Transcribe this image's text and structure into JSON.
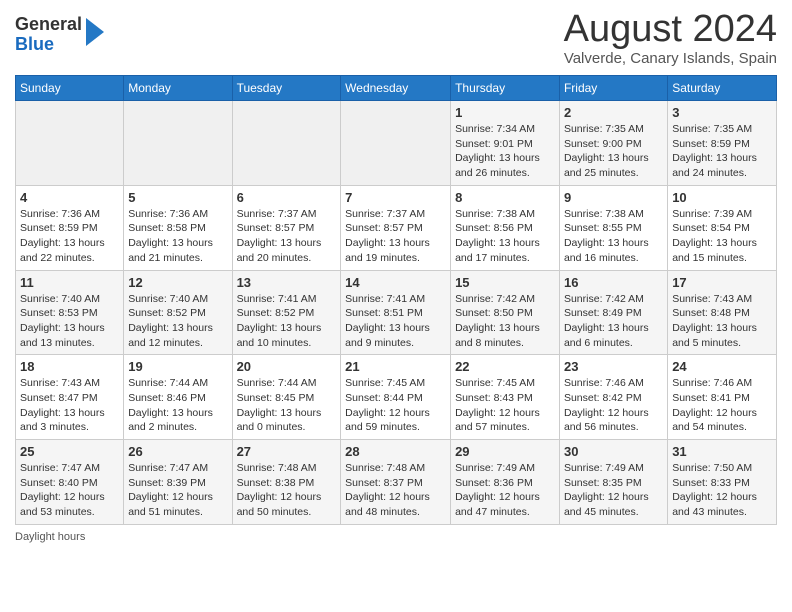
{
  "header": {
    "logo_general": "General",
    "logo_blue": "Blue",
    "month_title": "August 2024",
    "location": "Valverde, Canary Islands, Spain"
  },
  "calendar": {
    "days_of_week": [
      "Sunday",
      "Monday",
      "Tuesday",
      "Wednesday",
      "Thursday",
      "Friday",
      "Saturday"
    ],
    "weeks": [
      [
        {
          "day": "",
          "info": ""
        },
        {
          "day": "",
          "info": ""
        },
        {
          "day": "",
          "info": ""
        },
        {
          "day": "",
          "info": ""
        },
        {
          "day": "1",
          "info": "Sunrise: 7:34 AM\nSunset: 9:01 PM\nDaylight: 13 hours and 26 minutes."
        },
        {
          "day": "2",
          "info": "Sunrise: 7:35 AM\nSunset: 9:00 PM\nDaylight: 13 hours and 25 minutes."
        },
        {
          "day": "3",
          "info": "Sunrise: 7:35 AM\nSunset: 8:59 PM\nDaylight: 13 hours and 24 minutes."
        }
      ],
      [
        {
          "day": "4",
          "info": "Sunrise: 7:36 AM\nSunset: 8:59 PM\nDaylight: 13 hours and 22 minutes."
        },
        {
          "day": "5",
          "info": "Sunrise: 7:36 AM\nSunset: 8:58 PM\nDaylight: 13 hours and 21 minutes."
        },
        {
          "day": "6",
          "info": "Sunrise: 7:37 AM\nSunset: 8:57 PM\nDaylight: 13 hours and 20 minutes."
        },
        {
          "day": "7",
          "info": "Sunrise: 7:37 AM\nSunset: 8:57 PM\nDaylight: 13 hours and 19 minutes."
        },
        {
          "day": "8",
          "info": "Sunrise: 7:38 AM\nSunset: 8:56 PM\nDaylight: 13 hours and 17 minutes."
        },
        {
          "day": "9",
          "info": "Sunrise: 7:38 AM\nSunset: 8:55 PM\nDaylight: 13 hours and 16 minutes."
        },
        {
          "day": "10",
          "info": "Sunrise: 7:39 AM\nSunset: 8:54 PM\nDaylight: 13 hours and 15 minutes."
        }
      ],
      [
        {
          "day": "11",
          "info": "Sunrise: 7:40 AM\nSunset: 8:53 PM\nDaylight: 13 hours and 13 minutes."
        },
        {
          "day": "12",
          "info": "Sunrise: 7:40 AM\nSunset: 8:52 PM\nDaylight: 13 hours and 12 minutes."
        },
        {
          "day": "13",
          "info": "Sunrise: 7:41 AM\nSunset: 8:52 PM\nDaylight: 13 hours and 10 minutes."
        },
        {
          "day": "14",
          "info": "Sunrise: 7:41 AM\nSunset: 8:51 PM\nDaylight: 13 hours and 9 minutes."
        },
        {
          "day": "15",
          "info": "Sunrise: 7:42 AM\nSunset: 8:50 PM\nDaylight: 13 hours and 8 minutes."
        },
        {
          "day": "16",
          "info": "Sunrise: 7:42 AM\nSunset: 8:49 PM\nDaylight: 13 hours and 6 minutes."
        },
        {
          "day": "17",
          "info": "Sunrise: 7:43 AM\nSunset: 8:48 PM\nDaylight: 13 hours and 5 minutes."
        }
      ],
      [
        {
          "day": "18",
          "info": "Sunrise: 7:43 AM\nSunset: 8:47 PM\nDaylight: 13 hours and 3 minutes."
        },
        {
          "day": "19",
          "info": "Sunrise: 7:44 AM\nSunset: 8:46 PM\nDaylight: 13 hours and 2 minutes."
        },
        {
          "day": "20",
          "info": "Sunrise: 7:44 AM\nSunset: 8:45 PM\nDaylight: 13 hours and 0 minutes."
        },
        {
          "day": "21",
          "info": "Sunrise: 7:45 AM\nSunset: 8:44 PM\nDaylight: 12 hours and 59 minutes."
        },
        {
          "day": "22",
          "info": "Sunrise: 7:45 AM\nSunset: 8:43 PM\nDaylight: 12 hours and 57 minutes."
        },
        {
          "day": "23",
          "info": "Sunrise: 7:46 AM\nSunset: 8:42 PM\nDaylight: 12 hours and 56 minutes."
        },
        {
          "day": "24",
          "info": "Sunrise: 7:46 AM\nSunset: 8:41 PM\nDaylight: 12 hours and 54 minutes."
        }
      ],
      [
        {
          "day": "25",
          "info": "Sunrise: 7:47 AM\nSunset: 8:40 PM\nDaylight: 12 hours and 53 minutes."
        },
        {
          "day": "26",
          "info": "Sunrise: 7:47 AM\nSunset: 8:39 PM\nDaylight: 12 hours and 51 minutes."
        },
        {
          "day": "27",
          "info": "Sunrise: 7:48 AM\nSunset: 8:38 PM\nDaylight: 12 hours and 50 minutes."
        },
        {
          "day": "28",
          "info": "Sunrise: 7:48 AM\nSunset: 8:37 PM\nDaylight: 12 hours and 48 minutes."
        },
        {
          "day": "29",
          "info": "Sunrise: 7:49 AM\nSunset: 8:36 PM\nDaylight: 12 hours and 47 minutes."
        },
        {
          "day": "30",
          "info": "Sunrise: 7:49 AM\nSunset: 8:35 PM\nDaylight: 12 hours and 45 minutes."
        },
        {
          "day": "31",
          "info": "Sunrise: 7:50 AM\nSunset: 8:33 PM\nDaylight: 12 hours and 43 minutes."
        }
      ]
    ]
  },
  "footer": {
    "daylight_hours": "Daylight hours"
  }
}
